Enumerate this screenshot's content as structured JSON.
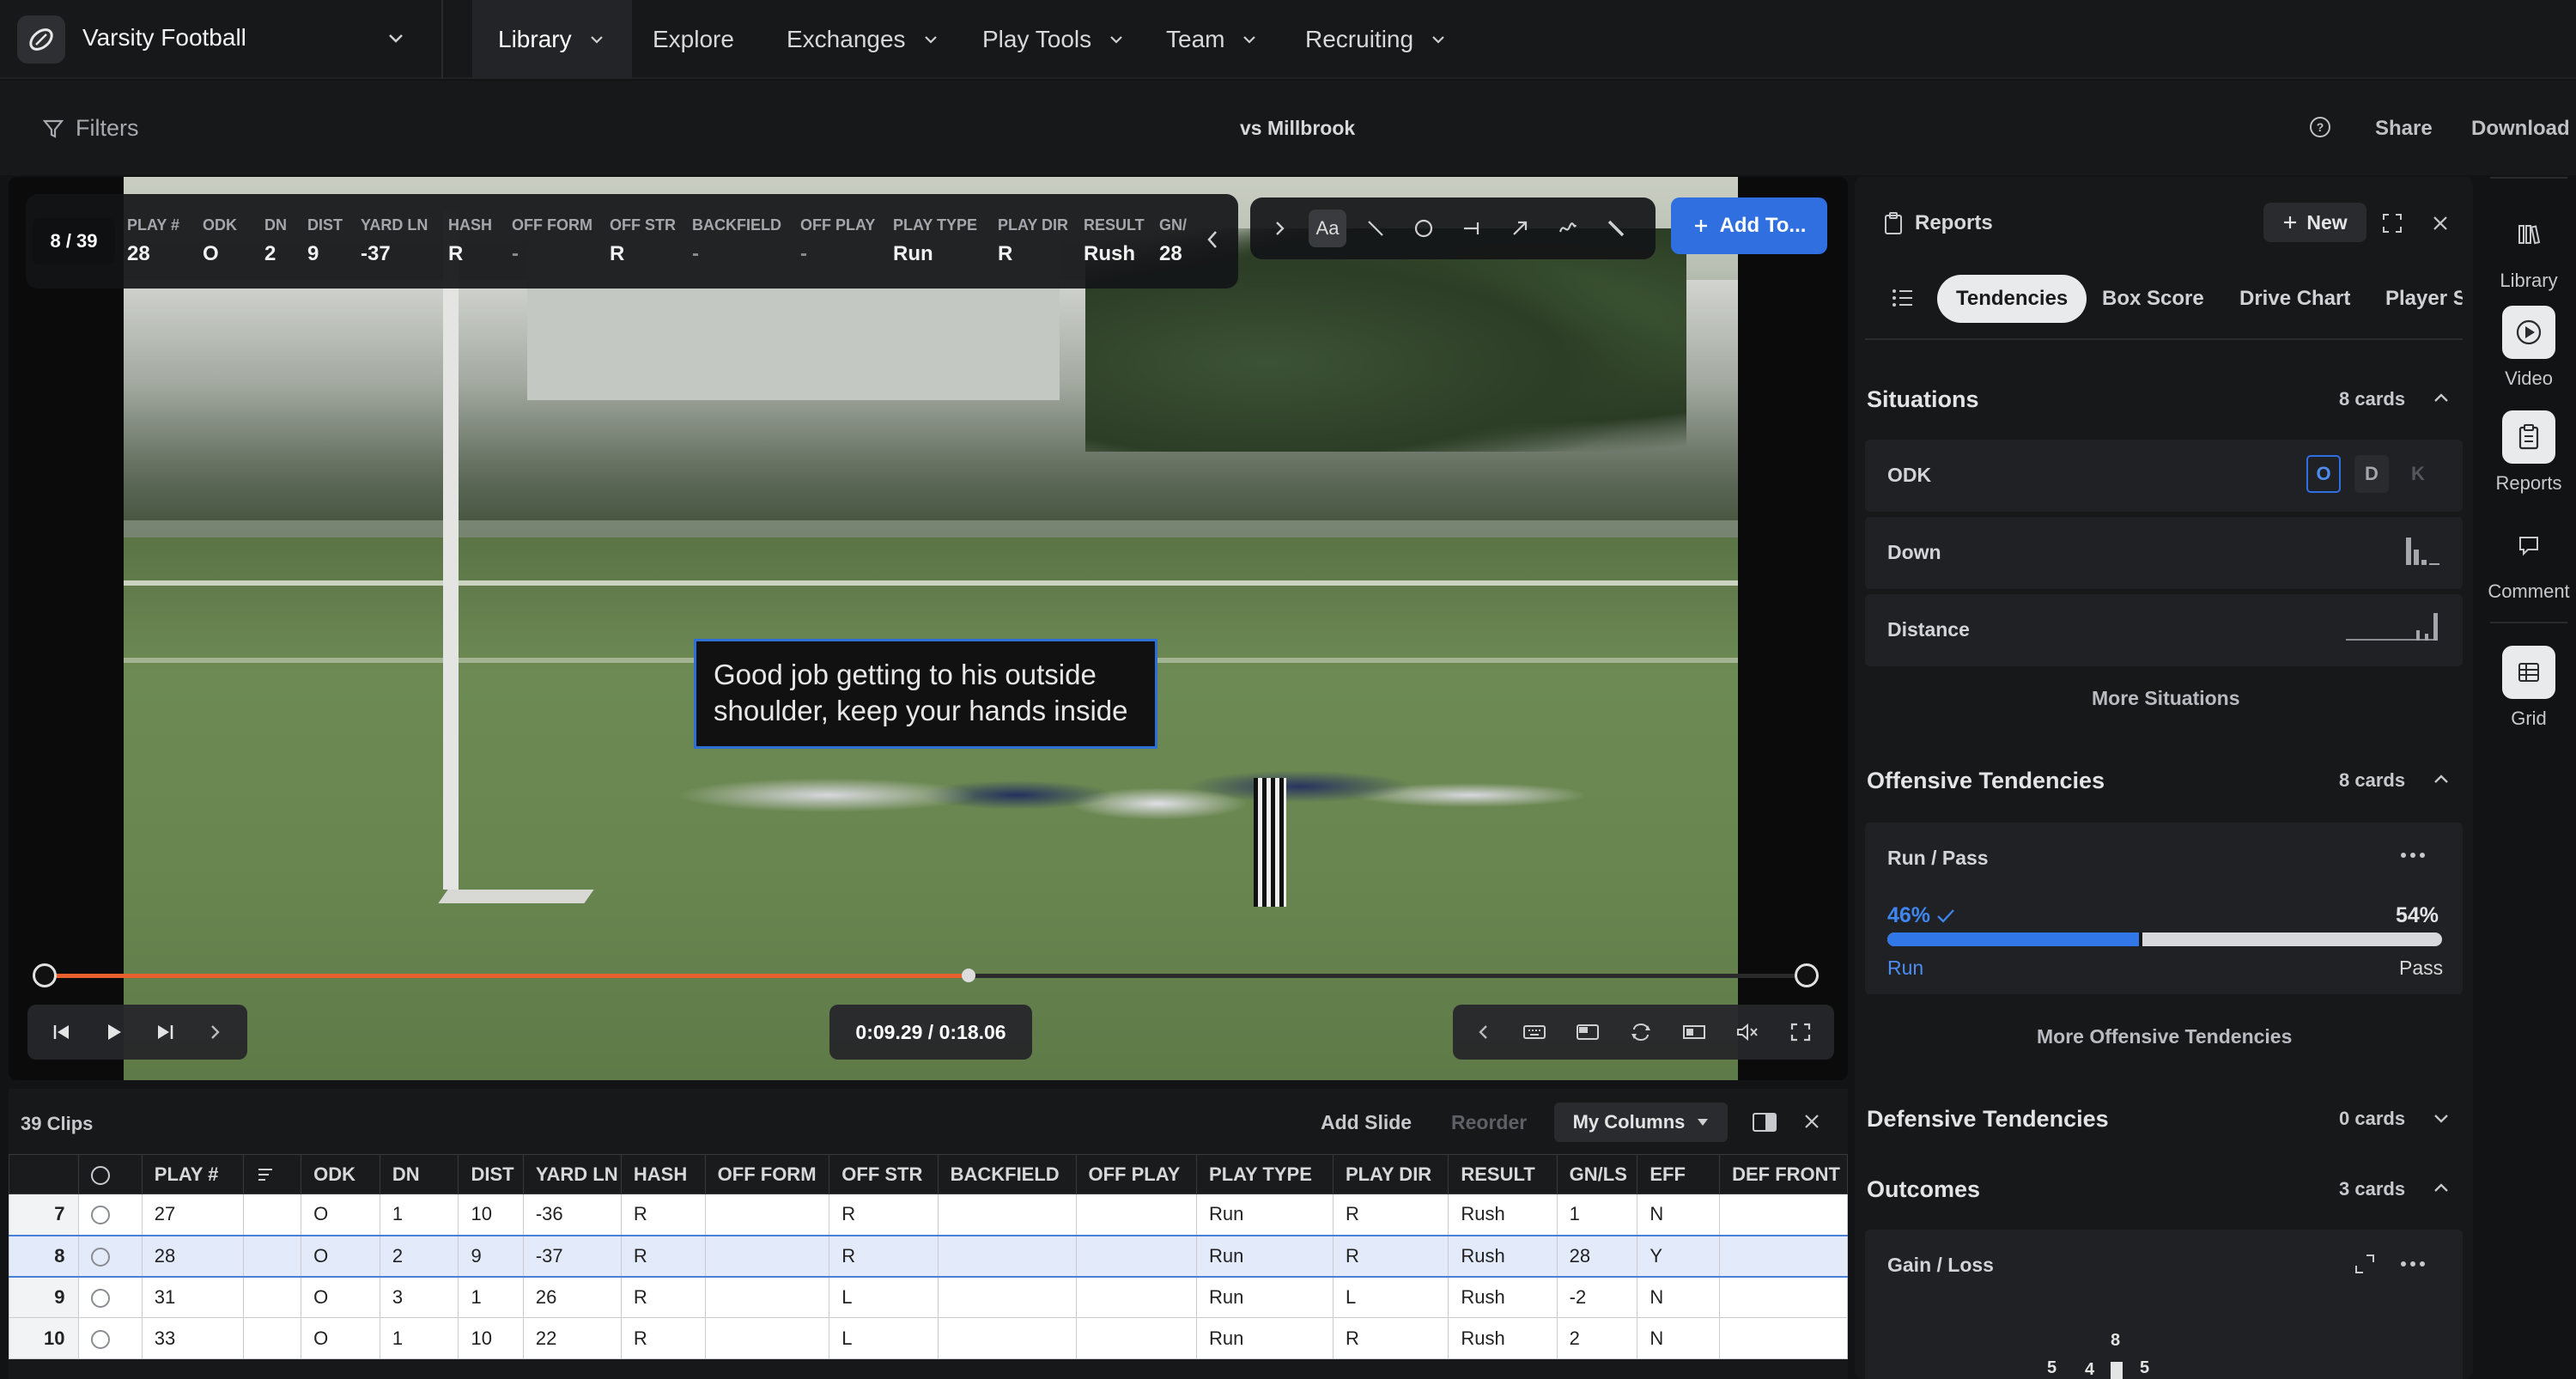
{
  "topbar": {
    "team": "Varsity Football",
    "nav": [
      {
        "label": "Library",
        "dropdown": true
      },
      {
        "label": "Explore",
        "dropdown": false
      },
      {
        "label": "Exchanges",
        "dropdown": true
      },
      {
        "label": "Play Tools",
        "dropdown": true
      },
      {
        "label": "Team",
        "dropdown": true
      },
      {
        "label": "Recruiting",
        "dropdown": true
      }
    ]
  },
  "filterbar": {
    "filters_label": "Filters",
    "title": "vs Millbrook",
    "share": "Share",
    "download": "Download"
  },
  "video": {
    "clip_counter": "8 / 39",
    "fields": [
      {
        "label": "PLAY #",
        "value": "28"
      },
      {
        "label": "ODK",
        "value": "O"
      },
      {
        "label": "DN",
        "value": "2"
      },
      {
        "label": "DIST",
        "value": "9"
      },
      {
        "label": "YARD LN",
        "value": "-37"
      },
      {
        "label": "HASH",
        "value": "R"
      },
      {
        "label": "OFF FORM",
        "value": "-"
      },
      {
        "label": "OFF STR",
        "value": "R"
      },
      {
        "label": "BACKFIELD",
        "value": "-"
      },
      {
        "label": "OFF PLAY",
        "value": "-"
      },
      {
        "label": "PLAY TYPE",
        "value": "Run"
      },
      {
        "label": "PLAY DIR",
        "value": "R"
      },
      {
        "label": "RESULT",
        "value": "Rush"
      },
      {
        "label": "GN/",
        "value": "28"
      }
    ],
    "text_tool": "Aa",
    "add_to": "Add To...",
    "comment": "Good job getting to his outside shoulder, keep your hands inside",
    "timecode": "0:09.29 / 0:18.06",
    "progress": 0.52,
    "accent_color": "#e8602e",
    "annotation_border": "#2d6fd6"
  },
  "table": {
    "clip_count": "39 Clips",
    "add_slide": "Add Slide",
    "reorder": "Reorder",
    "columns_menu": "My Columns",
    "headers": [
      "",
      "",
      "PLAY #",
      "",
      "ODK",
      "DN",
      "DIST",
      "YARD LN",
      "HASH",
      "OFF FORM",
      "OFF STR",
      "BACKFIELD",
      "OFF PLAY",
      "PLAY TYPE",
      "PLAY DIR",
      "RESULT",
      "GN/LS",
      "EFF",
      "DEF FRONT"
    ],
    "rows": [
      {
        "n": "7",
        "play": "27",
        "odk": "O",
        "dn": "1",
        "dist": "10",
        "yard": "-36",
        "hash": "R",
        "off_form": "",
        "off_str": "R",
        "backfield": "",
        "off_play": "",
        "play_type": "Run",
        "play_dir": "R",
        "result": "Rush",
        "gnls": "1",
        "eff": "N",
        "def_front": ""
      },
      {
        "n": "8",
        "play": "28",
        "odk": "O",
        "dn": "2",
        "dist": "9",
        "yard": "-37",
        "hash": "R",
        "off_form": "",
        "off_str": "R",
        "backfield": "",
        "off_play": "",
        "play_type": "Run",
        "play_dir": "R",
        "result": "Rush",
        "gnls": "28",
        "eff": "Y",
        "def_front": ""
      },
      {
        "n": "9",
        "play": "31",
        "odk": "O",
        "dn": "3",
        "dist": "1",
        "yard": "26",
        "hash": "R",
        "off_form": "",
        "off_str": "L",
        "backfield": "",
        "off_play": "",
        "play_type": "Run",
        "play_dir": "L",
        "result": "Rush",
        "gnls": "-2",
        "eff": "N",
        "def_front": ""
      },
      {
        "n": "10",
        "play": "33",
        "odk": "O",
        "dn": "1",
        "dist": "10",
        "yard": "22",
        "hash": "R",
        "off_form": "",
        "off_str": "L",
        "backfield": "",
        "off_play": "",
        "play_type": "Run",
        "play_dir": "R",
        "result": "Rush",
        "gnls": "2",
        "eff": "N",
        "def_front": ""
      }
    ],
    "selected_row": 1
  },
  "reports": {
    "title": "Reports",
    "new_label": "New",
    "tabs": [
      "Tendencies",
      "Box Score",
      "Drive Chart",
      "Player S"
    ],
    "situations": {
      "title": "Situations",
      "count": "8 cards",
      "odk_label": "ODK",
      "odk_options": [
        "O",
        "D",
        "K"
      ],
      "down_label": "Down",
      "distance_label": "Distance",
      "more": "More Situations"
    },
    "offensive": {
      "title": "Offensive Tendencies",
      "count": "8 cards",
      "card_label": "Run / Pass",
      "run_pct": "46%",
      "pass_pct": "54%",
      "run_label": "Run",
      "pass_label": "Pass",
      "run_fraction": 0.46,
      "more": "More Offensive Tendencies"
    },
    "defensive": {
      "title": "Defensive Tendencies",
      "count": "0 cards"
    },
    "outcomes": {
      "title": "Outcomes",
      "count": "3 cards",
      "card_label": "Gain / Loss",
      "chart_labels": [
        "5",
        "4",
        "8",
        "5"
      ]
    }
  },
  "rail": [
    {
      "label": "Library",
      "icon": "library-icon"
    },
    {
      "label": "Video",
      "icon": "play-circle-icon"
    },
    {
      "label": "Reports",
      "icon": "clipboard-icon"
    },
    {
      "label": "Comment",
      "icon": "comment-icon"
    },
    {
      "label": "Grid",
      "icon": "grid-icon"
    }
  ]
}
